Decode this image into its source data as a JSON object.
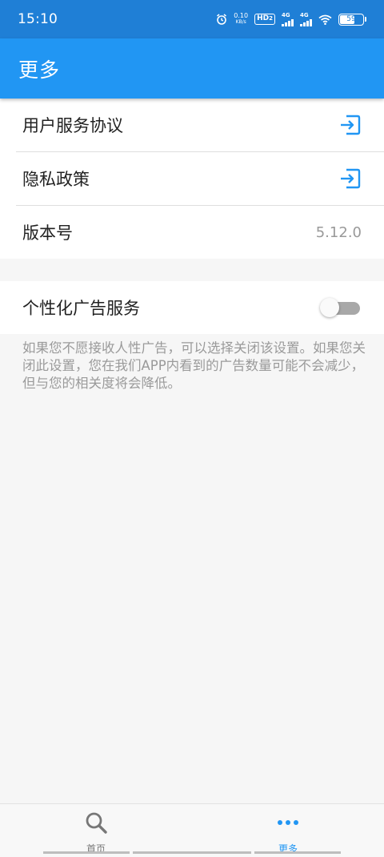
{
  "status_bar": {
    "time": "15:10",
    "net_speed_value": "0.10",
    "net_speed_unit": "KB/s",
    "hd_label": "HD",
    "hd_sub": "2",
    "sim1_label": "4G",
    "sim2_label": "4G",
    "battery_level": "59",
    "battery_fraction": 0.59
  },
  "app_bar": {
    "title": "更多"
  },
  "menu": {
    "items": [
      {
        "label": "用户服务协议",
        "icon": "enter-icon"
      },
      {
        "label": "隐私政策",
        "icon": "enter-icon"
      },
      {
        "label": "版本号",
        "value": "5.12.0"
      }
    ]
  },
  "ad_settings": {
    "label": "个性化广告服务",
    "enabled": false,
    "description": "如果您不愿接收人性广告，可以选择关闭该设置。如果您关闭此设置，您在我们APP内看到的广告数量可能不会减少，但与您的相关度将会降低。"
  },
  "bottom_nav": {
    "items": [
      {
        "label": "首页",
        "icon": "search-icon",
        "active": false
      },
      {
        "label": "更多",
        "icon": "more-dots-icon",
        "active": true
      }
    ]
  },
  "colors": {
    "status_bar": "#1f7fd6",
    "app_bar": "#2196f3",
    "accent": "#2196f3",
    "background": "#f6f6f6"
  }
}
